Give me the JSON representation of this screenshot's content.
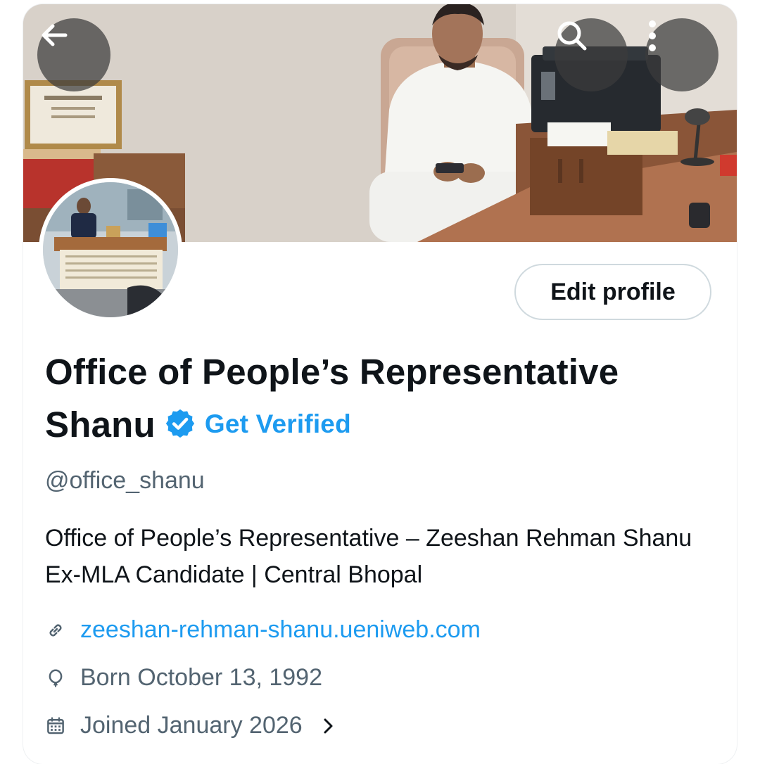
{
  "header": {
    "back_icon": "arrow-left-icon",
    "search_icon": "search-icon",
    "more_icon": "more-vertical-icon"
  },
  "profile": {
    "edit_button_label": "Edit profile",
    "name_line1": "Office of People’s Representative",
    "name_line2": "Shanu",
    "verified_icon": "verified-badge-icon",
    "get_verified_label": "Get Verified",
    "handle": "@office_shanu",
    "bio": "Office of People’s Representative – Zeeshan Rehman Shanu Ex-MLA Candidate | Central Bhopal",
    "website": "zeeshan-rehman-shanu.ueniweb.com",
    "born": "Born October 13, 1992",
    "joined": "Joined January 2026"
  },
  "colors": {
    "accent": "#1d9bf0",
    "text_primary": "#0f1419",
    "text_secondary": "#536471"
  }
}
